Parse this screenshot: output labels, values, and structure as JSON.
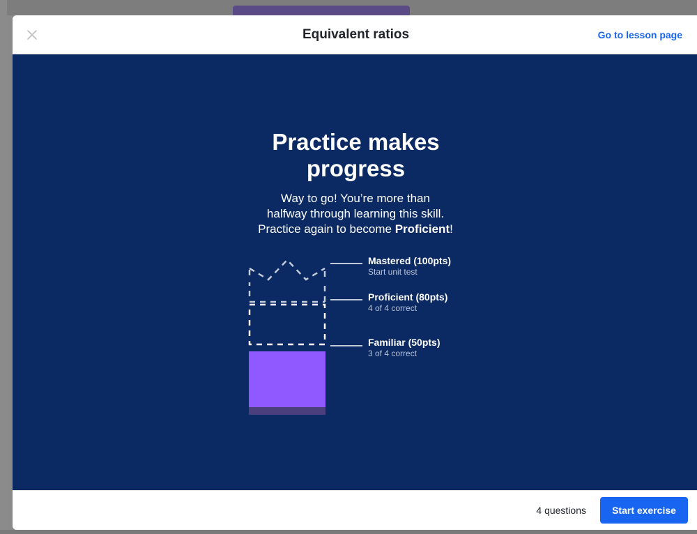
{
  "modal": {
    "title": "Equivalent ratios",
    "lesson_link": "Go to lesson page",
    "close_icon": "close-icon"
  },
  "body": {
    "headline_line1": "Practice makes",
    "headline_line2": "progress",
    "sub_line1": "Way to go! You’re more than",
    "sub_line2": "halfway through learning this skill.",
    "sub_line3_prefix": "Practice again to become ",
    "sub_line3_bold": "Proficient",
    "sub_line3_suffix": "!"
  },
  "levels": [
    {
      "name": "Mastered (100pts)",
      "detail": "Start unit test"
    },
    {
      "name": "Proficient (80pts)",
      "detail": "4 of 4 correct"
    },
    {
      "name": "Familiar (50pts)",
      "detail": "3 of 4 correct"
    }
  ],
  "footer": {
    "question_count": "4 questions",
    "start_button": "Start exercise"
  },
  "colors": {
    "body_bg": "#0b2962",
    "familiar_fill": "#9059ff",
    "accent": "#1865f2"
  }
}
